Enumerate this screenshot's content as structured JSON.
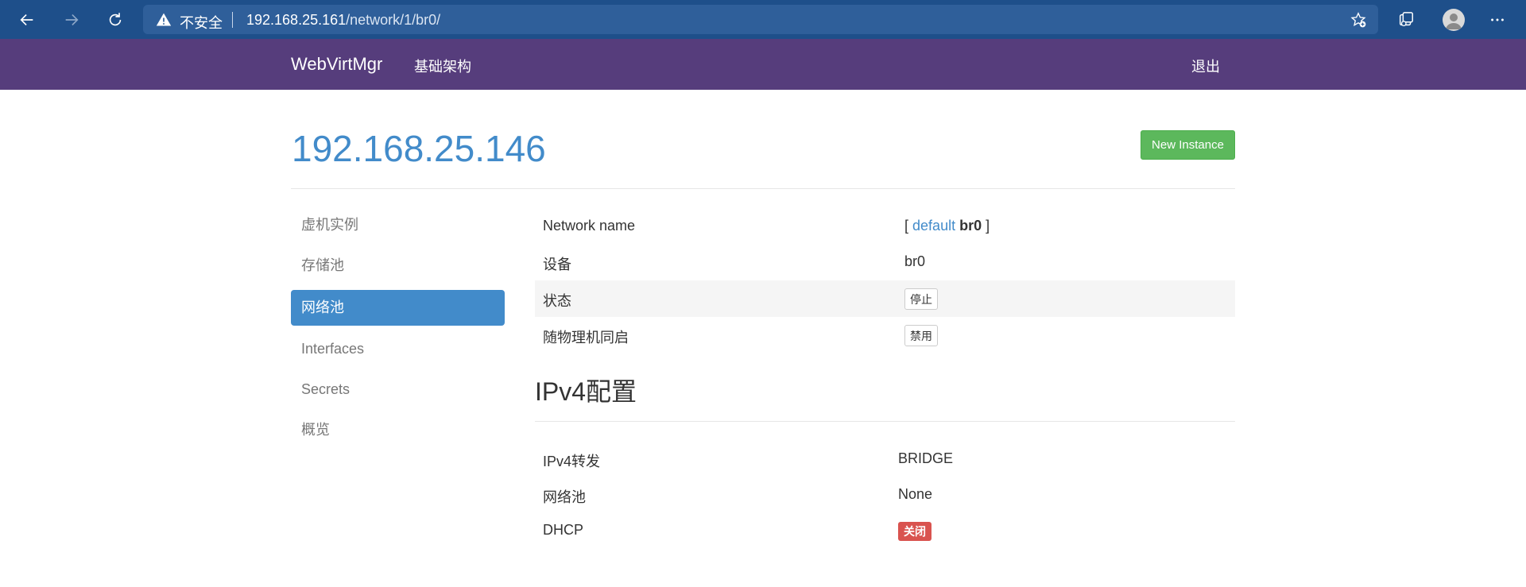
{
  "browser": {
    "not_secure": "不安全",
    "url_host": "192.168.25.161",
    "url_path": "/network/1/br0/",
    "icons": [
      "back-icon",
      "forward-icon",
      "refresh-icon",
      "warning-icon",
      "favorites-star-icon",
      "collections-icon",
      "profile-avatar-icon",
      "more-menu-icon"
    ]
  },
  "navbar": {
    "brand": "WebVirtMgr",
    "infra": "基础架构",
    "logout": "退出"
  },
  "header": {
    "title": "192.168.25.146",
    "new_instance": "New Instance"
  },
  "sidebar": {
    "items": [
      {
        "label": "虚机实例",
        "active": false
      },
      {
        "label": "存储池",
        "active": false
      },
      {
        "label": "网络池",
        "active": true
      },
      {
        "label": "Interfaces",
        "active": false
      },
      {
        "label": "Secrets",
        "active": false
      },
      {
        "label": "概览",
        "active": false
      }
    ]
  },
  "network": {
    "rows": [
      {
        "label": "Network name",
        "bracket_open": "[",
        "link": "default",
        "bold": "br0",
        "bracket_close": "]"
      },
      {
        "label": "设备",
        "value": "br0"
      },
      {
        "label": "状态",
        "button": "停止"
      },
      {
        "label": "随物理机同启",
        "button": "禁用"
      }
    ]
  },
  "ipv4": {
    "title": "IPv4配置",
    "rows": [
      {
        "label": "IPv4转发",
        "value": "BRIDGE"
      },
      {
        "label": "网络池",
        "value": "None"
      },
      {
        "label": "DHCP",
        "badge": "关闭"
      }
    ]
  },
  "colors": {
    "browser_bar": "#1e4f8a",
    "navbar": "#563d7c",
    "primary": "#428bca",
    "success": "#5cb85c",
    "danger": "#d9534f"
  }
}
